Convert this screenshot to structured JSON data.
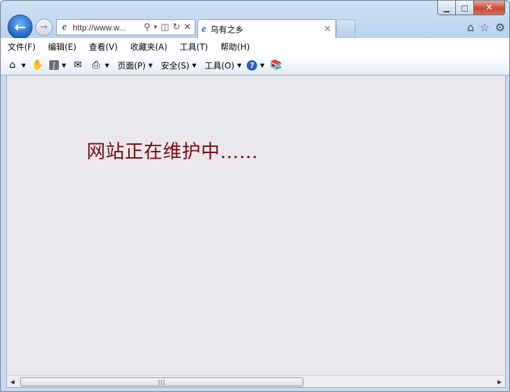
{
  "window": {
    "caption_buttons": {
      "minimize": "▁",
      "maximize": "□",
      "close": "✕"
    }
  },
  "navigation": {
    "back_icon": "←",
    "forward_icon": "→"
  },
  "address_bar": {
    "url": "http://www.w...",
    "search_icon": "⚲",
    "dropdown_icon": "▾",
    "compat_icon": "◫",
    "refresh_icon": "↻",
    "stop_icon": "✕"
  },
  "tabs": [
    {
      "title": "乌有之乡",
      "close_icon": "✕"
    }
  ],
  "toolbar_right": {
    "home_icon": "⌂",
    "favorites_icon": "☆",
    "tools_icon": "⚙"
  },
  "menu": [
    "文件(F)",
    "编辑(E)",
    "查看(V)",
    "收藏夹(A)",
    "工具(T)",
    "帮助(H)"
  ],
  "command_bar": {
    "page_label": "页面(P)",
    "safety_label": "安全(S)",
    "tools_label": "工具(O)"
  },
  "page": {
    "message": "网站正在维护中……"
  },
  "scrollbar": {
    "left_arrow": "◀",
    "right_arrow": "▶",
    "grip": "|||"
  }
}
